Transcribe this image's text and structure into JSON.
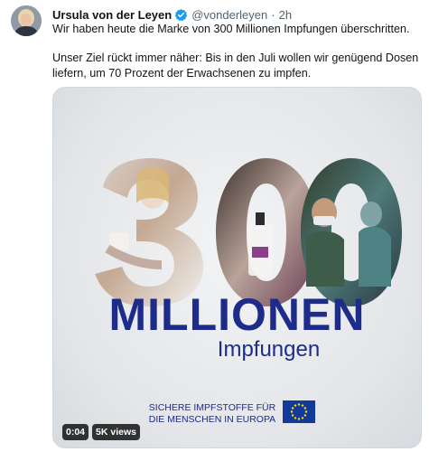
{
  "tweet": {
    "author_name": "Ursula von der Leyen",
    "handle": "@vonderleyen",
    "separator": "·",
    "time": "2h",
    "verified_icon": "verified-badge-icon",
    "paragraphs": [
      "Wir haben heute die Marke von 300 Millionen Impfungen überschritten.",
      "Unser Ziel rückt immer näher: Bis in den Juli wollen wir genügend Dosen liefern, um 70 Prozent der Erwachsenen zu impfen."
    ]
  },
  "media": {
    "big_number": "300",
    "headline": "MILLIONEN",
    "subline": "Impfungen",
    "eu_text_line1": "SICHERE IMPFSTOFFE FÜR",
    "eu_text_line2": "DIE MENSCHEN IN EUROPA",
    "video_time": "0:04",
    "views": "5K views"
  },
  "colors": {
    "accent_blue": "#1d2b8a",
    "verified_blue": "#1d9bf0",
    "eu_flag_blue": "#123a9a",
    "eu_star_yellow": "#ffdd00"
  }
}
